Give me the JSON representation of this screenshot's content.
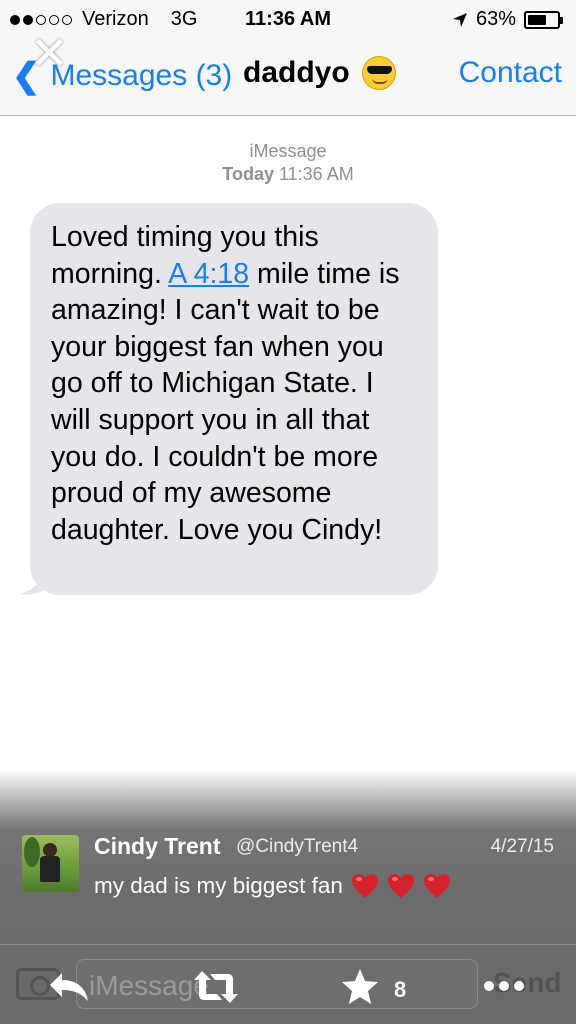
{
  "status": {
    "carrier": "Verizon",
    "network": "3G",
    "time": "11:36 AM",
    "battery": "63%",
    "battery_level": 0.63
  },
  "nav": {
    "back_label": "Messages (3)",
    "title": "daddyo",
    "title_emoji": "sunglasses-emoji",
    "contact_label": "Contact"
  },
  "thread": {
    "service": "iMessage",
    "day": "Today",
    "time": "11:36 AM",
    "message_before_link": "Loved timing you this morning. ",
    "message_link": "A 4:18",
    "message_after_link": " mile time is amazing! I can't wait to be your biggest fan when you go off to Michigan State. I will support you in all that you do. I couldn't be more proud of my awesome daughter. Love you Cindy!"
  },
  "input": {
    "placeholder": "iMessage",
    "send_label": "Send"
  },
  "tweet": {
    "name": "Cindy Trent",
    "handle": "@CindyTrent4",
    "date": "4/27/15",
    "text": "my dad is my biggest fan",
    "hearts": 3,
    "favorites": "8"
  },
  "colors": {
    "ios_blue": "#157efb",
    "bubble_gray": "#e5e5ea",
    "heart_red": "#d8222b"
  }
}
